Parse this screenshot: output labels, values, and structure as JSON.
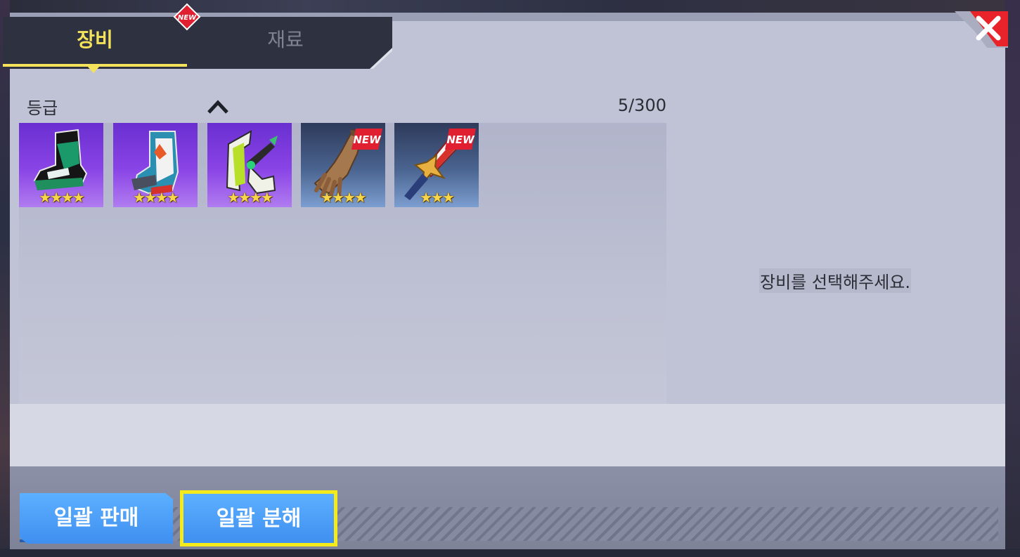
{
  "tabs": {
    "equipment_label": "장비",
    "material_label": "재료",
    "new_badge": "NEW"
  },
  "inventory": {
    "grade_label": "등급",
    "count": "5/300",
    "items": [
      {
        "name": "green-black-boots",
        "stars": "★★★★",
        "rarity_color": "#7a3be0",
        "is_new": false
      },
      {
        "name": "blue-white-boots",
        "stars": "★★★★",
        "rarity_color": "#7a3be0",
        "is_new": false
      },
      {
        "name": "green-white-staff",
        "stars": "★★★★",
        "rarity_color": "#7a3be0",
        "is_new": false
      },
      {
        "name": "brown-glove",
        "stars": "★★★★",
        "rarity_color": "#4a6490",
        "is_new": true,
        "new_badge": "NEW"
      },
      {
        "name": "golden-sword",
        "stars": "★★★",
        "rarity_color": "#4a6490",
        "is_new": true,
        "new_badge": "NEW"
      }
    ]
  },
  "detail": {
    "hint": "장비를 선택해주세요."
  },
  "actions": {
    "bulk_sell_label": "일괄 판매",
    "bulk_disassemble_label": "일괄 분해"
  },
  "colors": {
    "active_tab": "#f3e25a",
    "button_blue": "#4a9df5",
    "highlight_yellow": "#f5ea1a",
    "close_red": "#e8232a"
  }
}
